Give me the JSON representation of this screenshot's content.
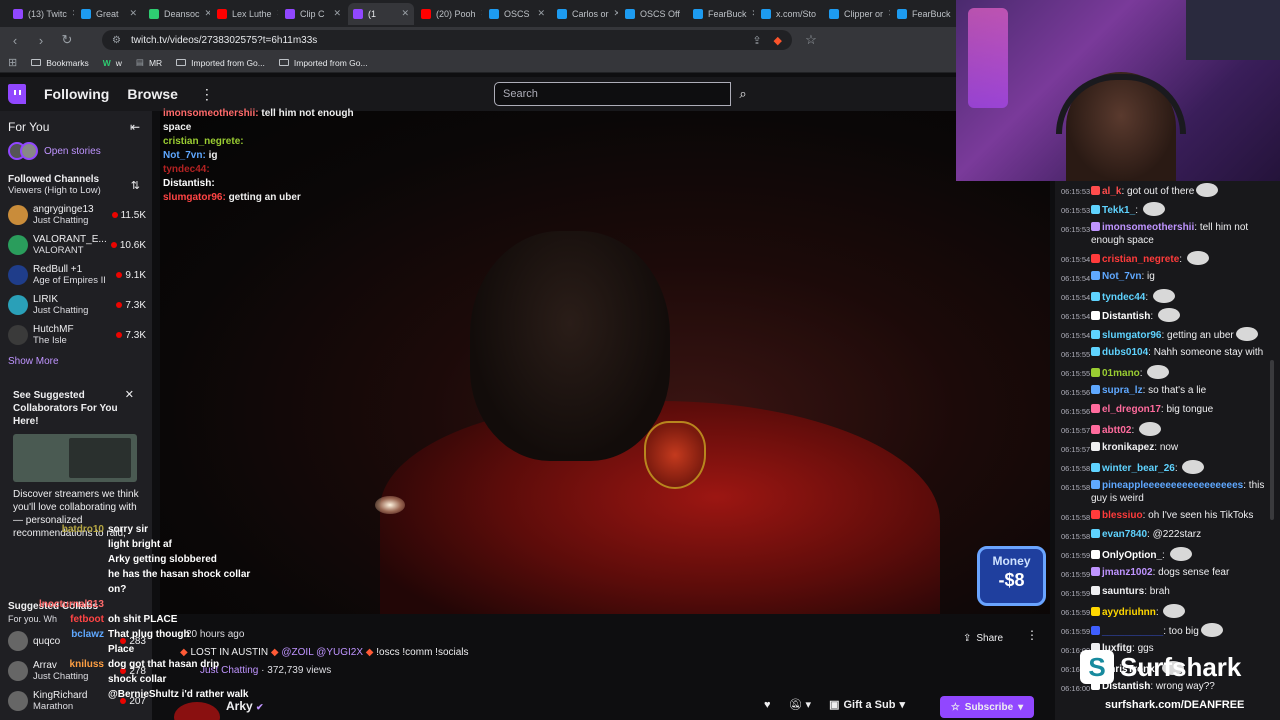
{
  "browser": {
    "tabs": [
      {
        "label": "(13) Twitc",
        "color": "#9147ff"
      },
      {
        "label": "Great",
        "color": "#1d9bf0"
      },
      {
        "label": "Deansoc",
        "color": "#2ecc71"
      },
      {
        "label": "Lex Luthe",
        "color": "#ff0000"
      },
      {
        "label": "Clip C",
        "color": "#9147ff"
      },
      {
        "label": "(1",
        "color": "#9147ff",
        "active": true
      },
      {
        "label": "(20) Pooh",
        "color": "#ff0000"
      },
      {
        "label": "OSCS",
        "color": "#1d9bf0"
      },
      {
        "label": "Carlos or",
        "color": "#1d9bf0"
      },
      {
        "label": "OSCS Off",
        "color": "#1d9bf0"
      },
      {
        "label": "FearBuck",
        "color": "#1d9bf0"
      },
      {
        "label": "x.com/Sto",
        "color": "#1d9bf0"
      },
      {
        "label": "Clipper or",
        "color": "#1d9bf0"
      },
      {
        "label": "FearBuck",
        "color": "#1d9bf0"
      }
    ],
    "url": "twitch.tv/videos/2738302575?t=6h11m33s",
    "bookmarks": [
      "Bookmarks",
      "w",
      "MR",
      "Imported from Go...",
      "Imported from Go..."
    ]
  },
  "nav": {
    "following": "Following",
    "browse": "Browse",
    "more": "⋮",
    "search_placeholder": "Search"
  },
  "sidebar": {
    "for_you": "For You",
    "collapse_icon": "⇤",
    "open_stories": "Open stories",
    "followed_title": "Followed Channels",
    "sort": "Viewers (High to Low)",
    "channels": [
      {
        "name": "angryginge13",
        "game": "Just Chatting",
        "viewers": "11.5K",
        "color": "#c98c3a"
      },
      {
        "name": "VALORANT_E...",
        "game": "VALORANT",
        "viewers": "10.6K",
        "color": "#2a9d5c"
      },
      {
        "name": "RedBull +1",
        "game": "Age of Empires II",
        "viewers": "9.1K",
        "color": "#1f3d8a"
      },
      {
        "name": "LIRIK",
        "game": "Just Chatting",
        "viewers": "7.3K",
        "color": "#2aa0b8"
      },
      {
        "name": "HutchMF",
        "game": "The Isle",
        "viewers": "7.3K",
        "color": "#3a3a3a"
      }
    ],
    "show_more": "Show More",
    "collab_title": "See Suggested Collaborators For You Here!",
    "collab_desc": "Discover streamers we think you'll love collaborating with — personalized recommendations to raid,",
    "suggested": "Suggested Collabs",
    "suggested_sub": "For you. Wh",
    "suggested_channels": [
      {
        "name": "quqco",
        "game": "",
        "viewers": "283"
      },
      {
        "name": "Arrav",
        "game": "Just Chatting",
        "viewers": "278"
      },
      {
        "name": "KingRichard",
        "game": "Marathon",
        "viewers": "207"
      }
    ]
  },
  "overlay_chat": [
    {
      "user": "imonsomeothershii:",
      "msg": "tell him not enough",
      "color": "#ff6b6b"
    },
    {
      "user": "",
      "msg": "space",
      "color": "#ffffff"
    },
    {
      "user": "cristian_negrete:",
      "msg": "",
      "color": "#9acd32"
    },
    {
      "user": "Not_7vn:",
      "msg": "ig",
      "color": "#5fa8ff"
    },
    {
      "user": "tyndec44:",
      "msg": "",
      "color": "#b22222"
    },
    {
      "user": "Distantish:",
      "msg": "",
      "color": "#ffffff"
    },
    {
      "user": "slumgator96:",
      "msg": "getting an uber",
      "color": "#ff4444"
    }
  ],
  "overlay_chat2": [
    {
      "user": "batdro10",
      "msg": "sorry sir",
      "color": "#b5a642"
    },
    {
      "user": "",
      "msg": "light bright af",
      "color": "#ffffff"
    },
    {
      "user": "",
      "msg": "Arky getting slobbered",
      "color": "#ffffff"
    },
    {
      "user": "",
      "msg": "he has the hasan shock collar",
      "color": "#ffffff"
    },
    {
      "user": "",
      "msg": "on?",
      "color": "#ffffff"
    },
    {
      "user": "lnocturnal313",
      "msg": "",
      "color": "#ff6b6b"
    },
    {
      "user": "fetboot",
      "msg": "oh shit PLACE",
      "color": "#ff4444"
    },
    {
      "user": "bclawz",
      "msg": "That plug though",
      "color": "#5fa8ff"
    },
    {
      "user": "",
      "msg": "Place",
      "color": "#ffffff"
    },
    {
      "user": "kniluss",
      "msg": "dog got that hasan drip",
      "color": "#ff9f43"
    },
    {
      "user": "",
      "msg": "shock collar",
      "color": "#ffffff"
    },
    {
      "user": "",
      "msg": "@BernieShultz i'd rather walk",
      "color": "#ffffff"
    }
  ],
  "video": {
    "money_label": "Money",
    "money_value": "-$8",
    "ago": "20 hours ago",
    "title_plain": "LOST IN AUSTIN",
    "title_tag1": "@ZOIL",
    "title_tag2": "@YUGI2X",
    "title_rest": "!oscs !comm !socials",
    "category": "Just Chatting",
    "views": "372,739 views",
    "channel": "Arky",
    "share": "Share",
    "gift": "Gift a Sub",
    "subscribe": "Subscribe"
  },
  "chat": [
    {
      "ts": "06:15:53",
      "user": "al_k",
      "msg": "got out of there",
      "color": "#ff4d4d",
      "emote": true
    },
    {
      "ts": "06:15:53",
      "user": "Tekk1_",
      "msg": "",
      "color": "#5fd3ff",
      "emote": true
    },
    {
      "ts": "06:15:53",
      "user": "imonsomeothershii",
      "msg": "tell him not enough space",
      "color": "#bf94ff"
    },
    {
      "ts": "06:15:54",
      "user": "cristian_negrete",
      "msg": "",
      "color": "#ff3b3b",
      "emote": true
    },
    {
      "ts": "06:15:54",
      "user": "Not_7vn",
      "msg": "ig",
      "color": "#5fa8ff"
    },
    {
      "ts": "06:15:54",
      "user": "tyndec44",
      "msg": "",
      "color": "#5fd3ff",
      "emote": true
    },
    {
      "ts": "06:15:54",
      "user": "Distantish",
      "msg": "",
      "color": "#ffffff",
      "emote": true
    },
    {
      "ts": "06:15:54",
      "user": "slumgator96",
      "msg": "getting an uber",
      "color": "#5fd3ff",
      "emote": true
    },
    {
      "ts": "06:15:55",
      "user": "dubs0104",
      "msg": "Nahh someone stay with",
      "color": "#5fd3ff"
    },
    {
      "ts": "06:15:55",
      "user": "01mano",
      "msg": "",
      "color": "#9acd32",
      "emote": true
    },
    {
      "ts": "06:15:56",
      "user": "supra_lz",
      "msg": "so that's a lie",
      "color": "#5fa8ff"
    },
    {
      "ts": "06:15:56",
      "user": "el_dregon17",
      "msg": "big tongue",
      "color": "#ff6b9d"
    },
    {
      "ts": "06:15:57",
      "user": "abtt02",
      "msg": "",
      "color": "#ff6b9d",
      "emote": true
    },
    {
      "ts": "06:15:57",
      "user": "kronikapez",
      "msg": "now",
      "color": "#efeff1"
    },
    {
      "ts": "06:15:58",
      "user": "winter_bear_26",
      "msg": "",
      "color": "#5fd3ff",
      "emote": true
    },
    {
      "ts": "06:15:58",
      "user": "pineappleeeeeeeeeeeeeeeees",
      "msg": "this guy is weird",
      "color": "#5fa8ff"
    },
    {
      "ts": "06:15:58",
      "user": "blessiuo",
      "msg": "oh I've seen his TikToks",
      "color": "#ff3b3b"
    },
    {
      "ts": "06:15:58",
      "user": "evan7840",
      "msg": "@222starz",
      "color": "#5fd3ff"
    },
    {
      "ts": "06:15:59",
      "user": "OnlyOption_",
      "msg": "",
      "color": "#ffffff",
      "emote": true
    },
    {
      "ts": "06:15:59",
      "user": "jmanz1002",
      "msg": "dogs sense fear",
      "color": "#bf94ff"
    },
    {
      "ts": "06:15:59",
      "user": "saunturs",
      "msg": "brah",
      "color": "#efeff1"
    },
    {
      "ts": "06:15:59",
      "user": "ayydriuhnn",
      "msg": "",
      "color": "#ffd700",
      "emote": true
    },
    {
      "ts": "06:15:59",
      "user": "___________",
      "msg": "too big",
      "color": "#3f5fff",
      "emote": true
    },
    {
      "ts": "06:16:00",
      "user": "luxfitg",
      "msg": "ggs",
      "color": "#efeff1"
    },
    {
      "ts": "06:16:00",
      "user": "ChrisTronx",
      "msg": "",
      "color": "#ffffff",
      "emote": true
    },
    {
      "ts": "06:16:00",
      "user": "Distantish",
      "msg": "wrong way??",
      "color": "#ffffff"
    }
  ],
  "sponsor": {
    "name": "Surfshark",
    "url": "surfshark.com/DEANFREE"
  }
}
